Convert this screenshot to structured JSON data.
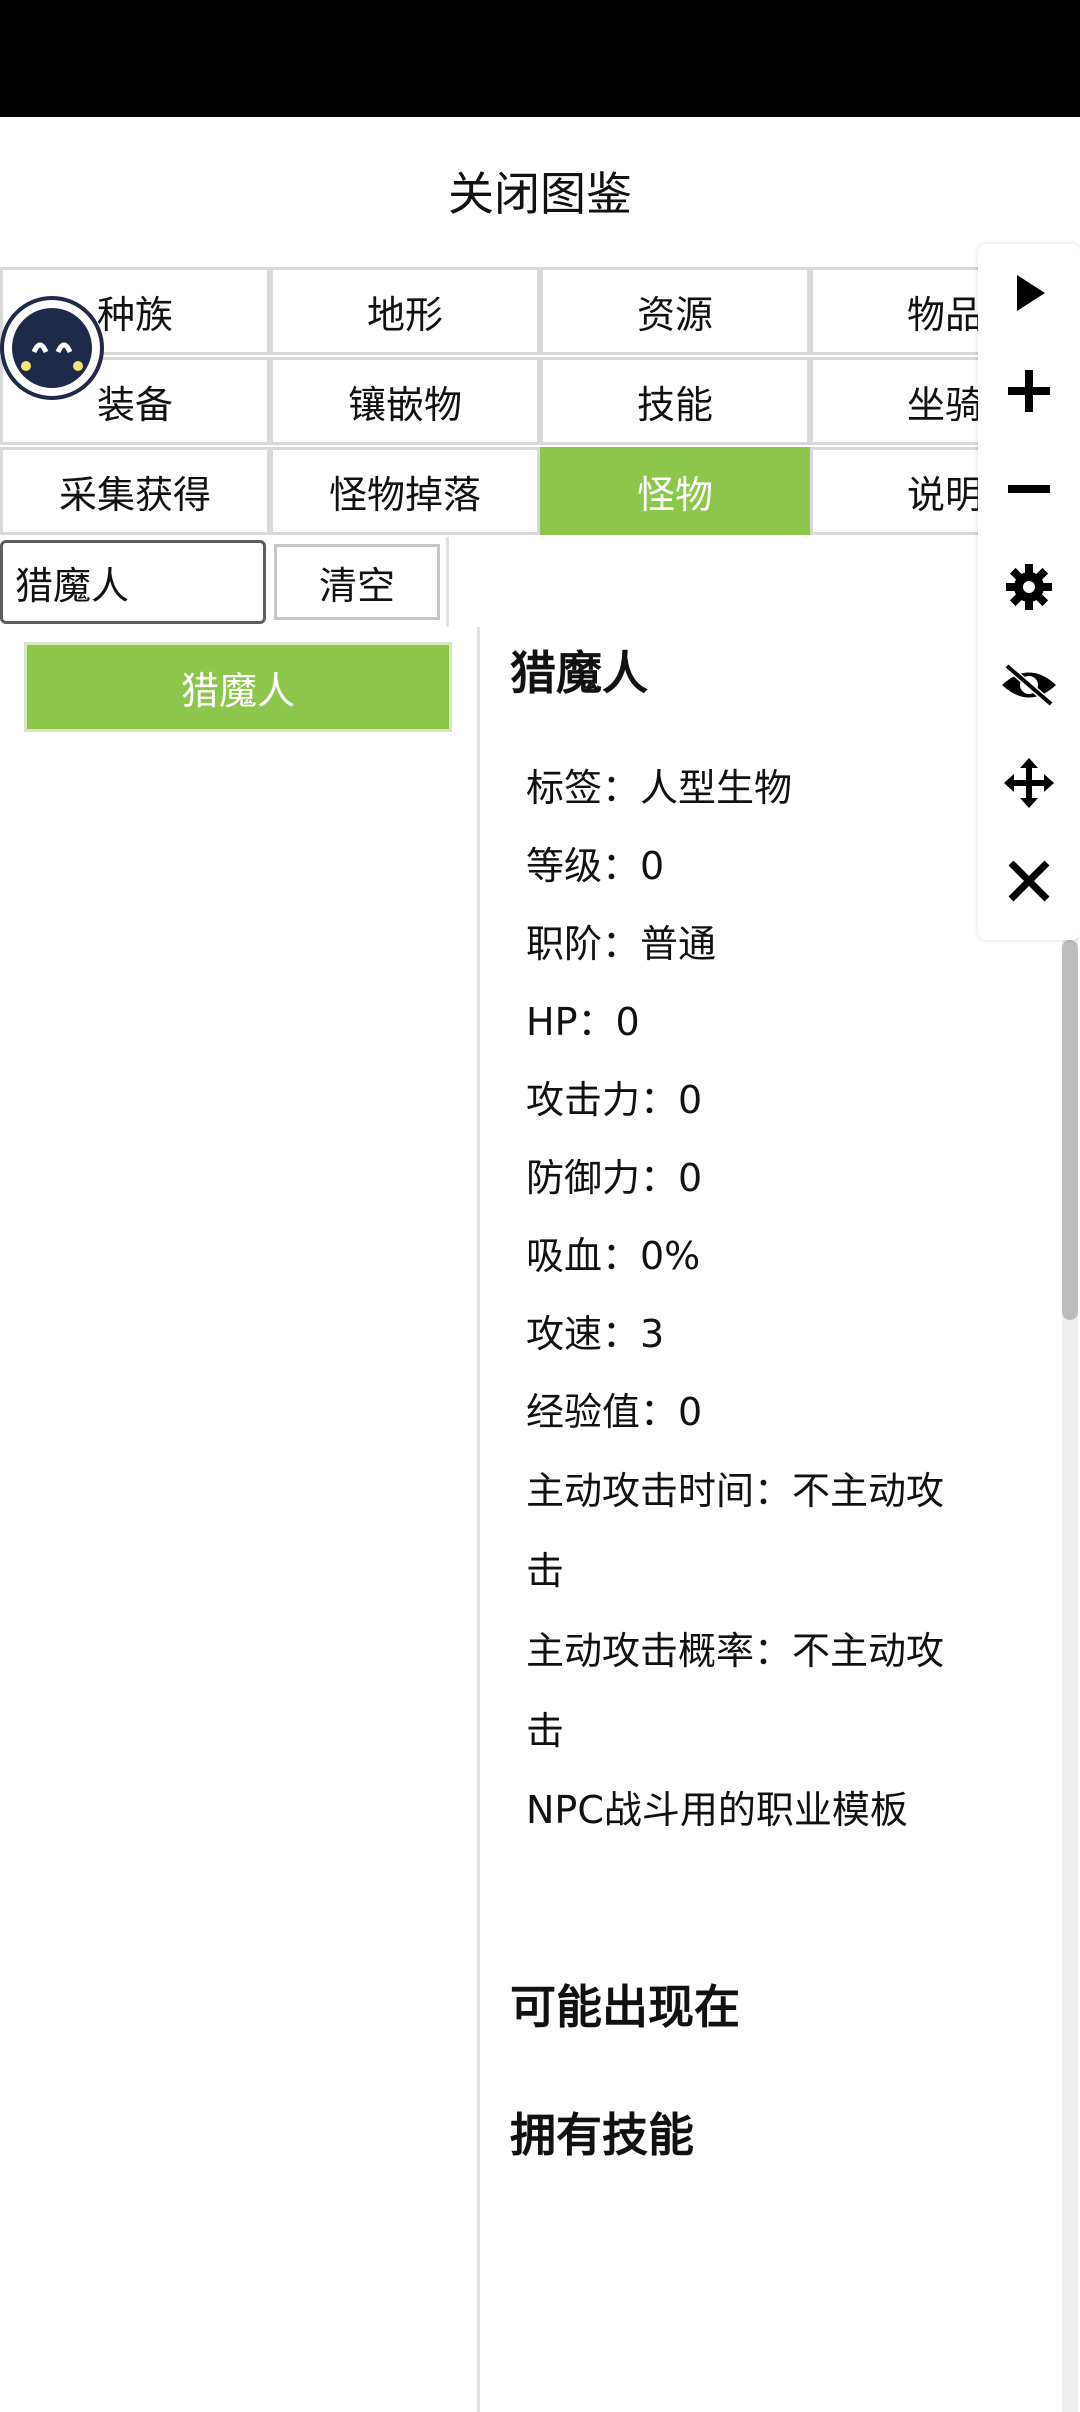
{
  "title": "关闭图鉴",
  "tabs": [
    [
      "种族",
      "地形",
      "资源",
      "物品"
    ],
    [
      "装备",
      "镶嵌物",
      "技能",
      "坐骑"
    ],
    [
      "采集获得",
      "怪物掉落",
      "怪物",
      "说明"
    ]
  ],
  "active_tab": "怪物",
  "search": {
    "value": "猎魔人",
    "clear_label": "清空"
  },
  "results": [
    "猎魔人"
  ],
  "detail": {
    "name": "猎魔人",
    "attributes": [
      "标签：人型生物",
      "等级：0",
      "职阶：普通",
      "HP：0",
      "攻击力：0",
      "防御力：0",
      "吸血：0%",
      "攻速：3",
      "经验值：0"
    ],
    "wrapped_attributes": [
      [
        "主动攻击时间：不主动攻",
        "击"
      ],
      [
        "主动攻击概率：不主动攻",
        "击"
      ]
    ],
    "note": "NPC战斗用的职业模板",
    "sections": [
      "可能出现在",
      "拥有技能"
    ]
  },
  "toolbar_icons": [
    "play-icon",
    "plus-icon",
    "minus-icon",
    "gear-icon",
    "eye-off-icon",
    "move-icon",
    "close-icon"
  ],
  "colors": {
    "accent": "#8cc64a",
    "status_bar": "#000000"
  }
}
